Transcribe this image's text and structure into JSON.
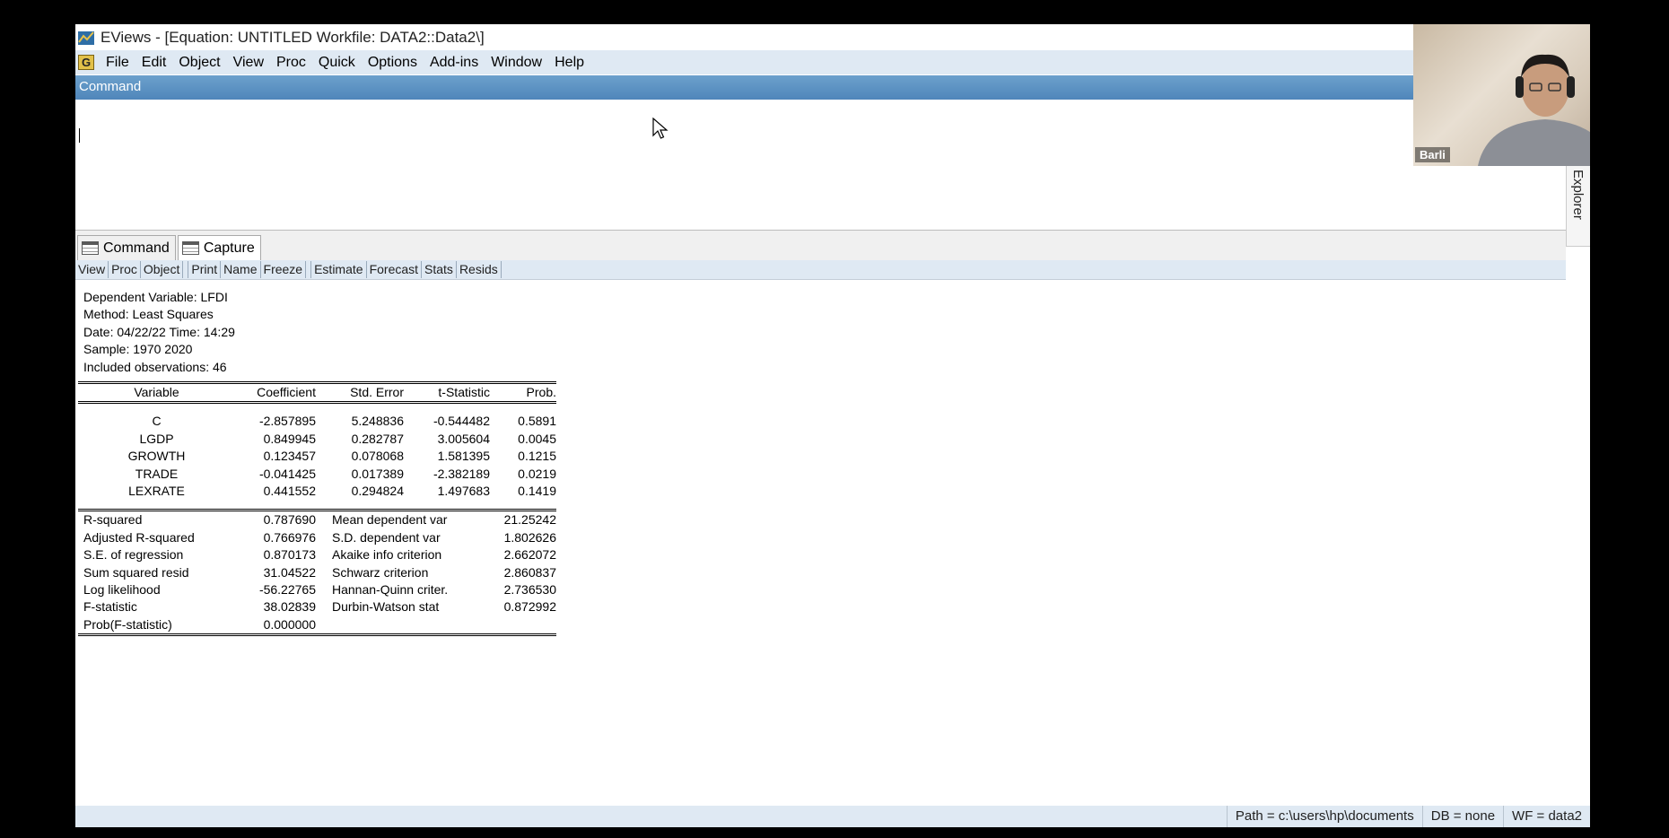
{
  "window": {
    "title": "EViews - [Equation: UNTITLED   Workfile: DATA2::Data2\\]"
  },
  "menu": [
    "File",
    "Edit",
    "Object",
    "View",
    "Proc",
    "Quick",
    "Options",
    "Add-ins",
    "Window",
    "Help"
  ],
  "menu_badge": "G",
  "command_pane": {
    "header": "Command",
    "value": ""
  },
  "explorer_label": "Explorer",
  "tabs": [
    {
      "label": "Command"
    },
    {
      "label": "Capture"
    }
  ],
  "equation_toolbar": [
    "View",
    "Proc",
    "Object",
    "Print",
    "Name",
    "Freeze",
    "Estimate",
    "Forecast",
    "Stats",
    "Resids"
  ],
  "estimation": {
    "header_lines": [
      "Dependent Variable: LFDI",
      "Method: Least Squares",
      "Date: 04/22/22   Time: 14:29",
      "Sample: 1970 2020",
      "Included observations: 46"
    ],
    "columns": [
      "Variable",
      "Coefficient",
      "Std. Error",
      "t-Statistic",
      "Prob."
    ],
    "rows": [
      [
        "C",
        "-2.857895",
        "5.248836",
        "-0.544482",
        "0.5891"
      ],
      [
        "LGDP",
        "0.849945",
        "0.282787",
        "3.005604",
        "0.0045"
      ],
      [
        "GROWTH",
        "0.123457",
        "0.078068",
        "1.581395",
        "0.1215"
      ],
      [
        "TRADE",
        "-0.041425",
        "0.017389",
        "-2.382189",
        "0.0219"
      ],
      [
        "LEXRATE",
        "0.441552",
        "0.294824",
        "1.497683",
        "0.1419"
      ]
    ],
    "stats": [
      [
        "R-squared",
        "0.787690",
        "Mean dependent var",
        "21.25242"
      ],
      [
        "Adjusted R-squared",
        "0.766976",
        "S.D. dependent var",
        "1.802626"
      ],
      [
        "S.E. of regression",
        "0.870173",
        "Akaike info criterion",
        "2.662072"
      ],
      [
        "Sum squared resid",
        "31.04522",
        "Schwarz criterion",
        "2.860837"
      ],
      [
        "Log likelihood",
        "-56.22765",
        "Hannan-Quinn criter.",
        "2.736530"
      ],
      [
        "F-statistic",
        "38.02839",
        "Durbin-Watson stat",
        "0.872992"
      ],
      [
        "Prob(F-statistic)",
        "0.000000",
        "",
        ""
      ]
    ]
  },
  "status_bar": [
    "Path = c:\\users\\hp\\documents",
    "DB = none",
    "WF = data2"
  ],
  "video": {
    "participant_name": "Barli"
  },
  "colors": {
    "menu_bg": "#dfe9f3",
    "command_header": "#5b8fc2"
  }
}
